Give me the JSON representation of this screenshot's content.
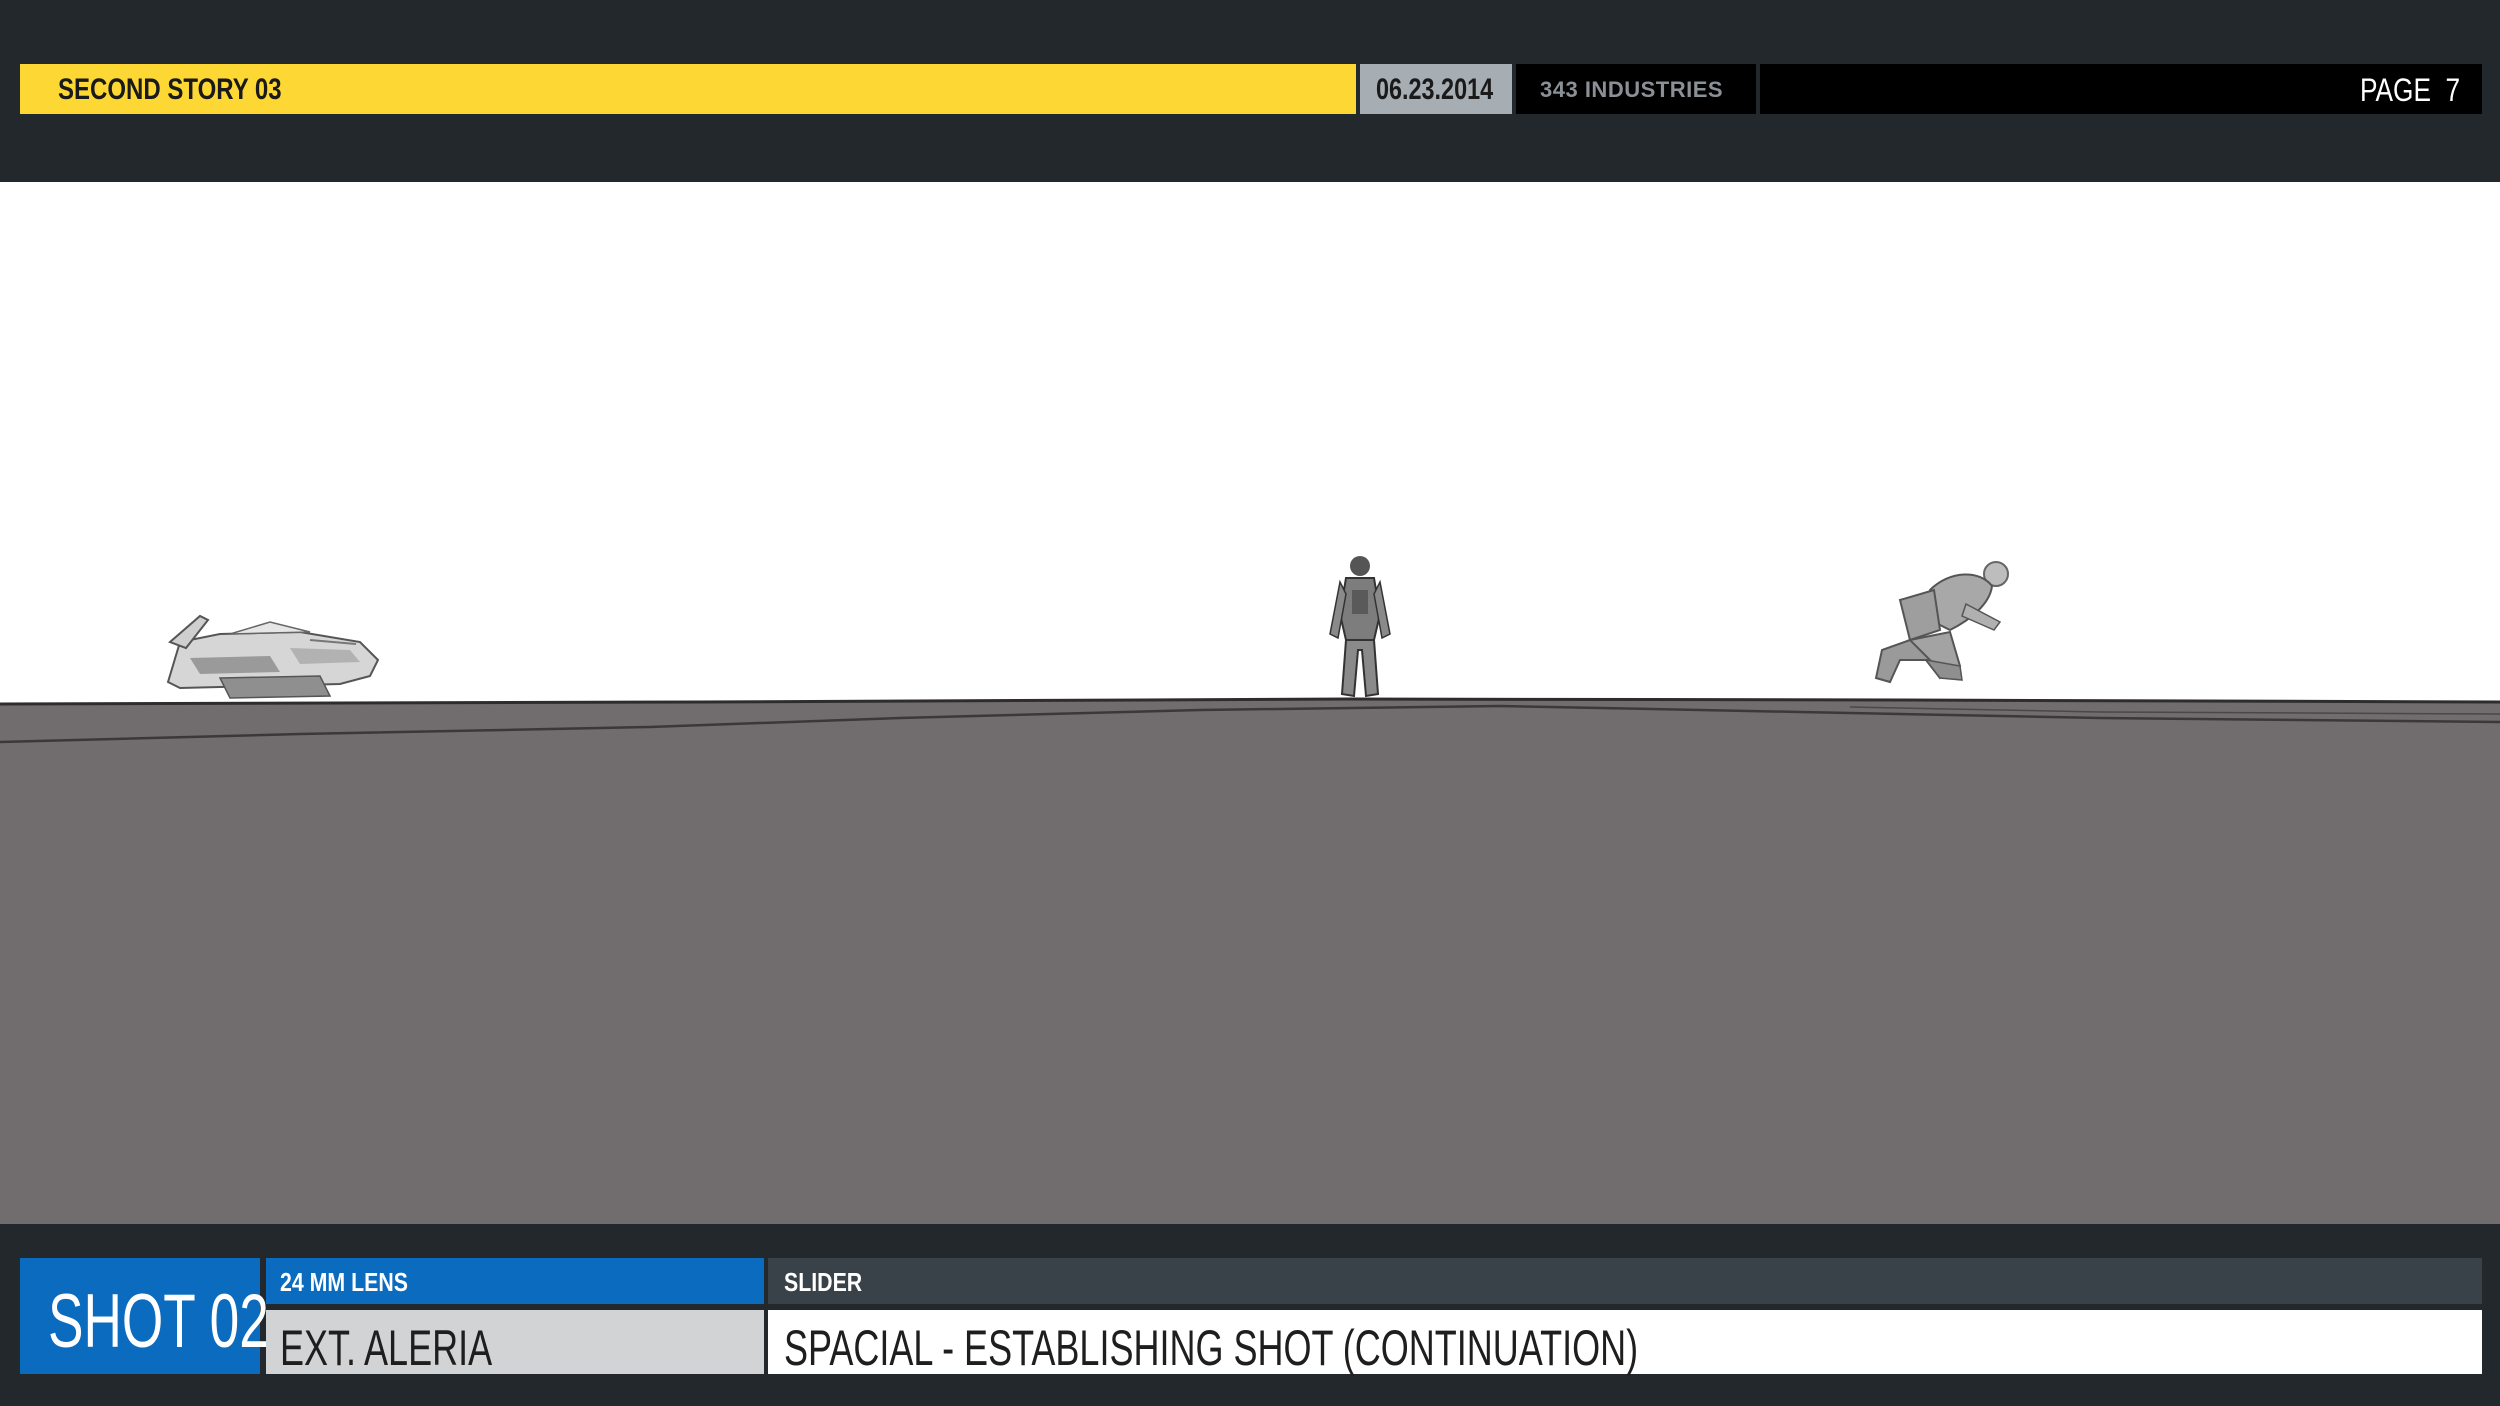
{
  "header": {
    "project_title": "SECOND STORY 03",
    "date": "06.23.2014",
    "studio": "343 INDUSTRIES",
    "page_label": "PAGE",
    "page_number": "7"
  },
  "shot": {
    "shot_label": "SHOT 02",
    "lens": "24 MM LENS",
    "location": "EXT.  ALERIA",
    "camera_move": "SLIDER",
    "description": "SPACIAL - ESTABLISHING SHOT (CONTINUATION)"
  },
  "colors": {
    "background": "#23282d",
    "title_yellow": "#fdd835",
    "date_gray": "#a6aeb4",
    "shot_blue": "#0a6bbf",
    "ground_gray": "#716d6e",
    "sky_white": "#ffffff"
  }
}
